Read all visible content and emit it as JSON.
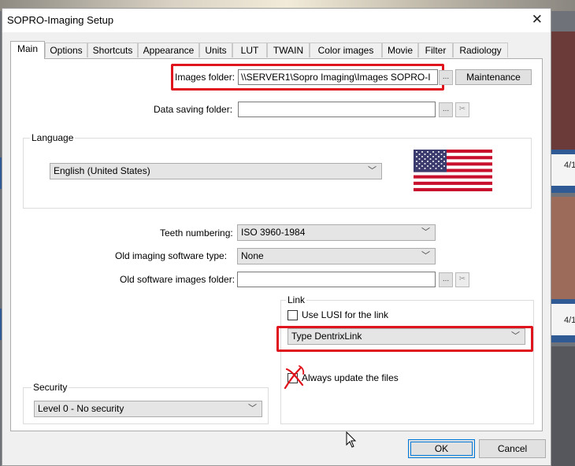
{
  "window": {
    "title": "SOPRO-Imaging Setup",
    "close_glyph": "✕"
  },
  "tabs": [
    {
      "label": "Main",
      "active": true
    },
    {
      "label": "Options"
    },
    {
      "label": "Shortcuts"
    },
    {
      "label": "Appearance"
    },
    {
      "label": "Units"
    },
    {
      "label": "LUT"
    },
    {
      "label": "TWAIN"
    },
    {
      "label": "Color images"
    },
    {
      "label": "Movie"
    },
    {
      "label": "Filter"
    },
    {
      "label": "Radiology"
    }
  ],
  "main": {
    "images_folder": {
      "label": "Images folder:",
      "value": "\\\\SERVER1\\Sopro Imaging\\Images SOPRO-I"
    },
    "browse_button_label": "...",
    "maintenance_button_label": "Maintenance",
    "data_saving_folder": {
      "label": "Data saving folder:",
      "value": ""
    },
    "language": {
      "group_label": "Language",
      "selected": "English (United States)",
      "flag_icon": "us-flag-icon"
    },
    "teeth_numbering": {
      "label": "Teeth numbering:",
      "selected": "ISO 3960-1984"
    },
    "old_software_type": {
      "label": "Old imaging software type:",
      "selected": "None"
    },
    "old_software_folder": {
      "label": "Old software images folder:",
      "value": ""
    },
    "link": {
      "group_label": "Link",
      "use_lusi_label": "Use LUSI for the link",
      "use_lusi_checked": false,
      "type_selected": "Type DentrixLink",
      "always_update_label": "Always update the files",
      "always_update_checked": false
    },
    "security": {
      "group_label": "Security",
      "selected": "Level 0 - No security"
    }
  },
  "footer": {
    "ok_label": "OK",
    "cancel_label": "Cancel"
  },
  "background": {
    "date_fragment_1": "4/1",
    "date_fragment_2": "4/1"
  },
  "colors": {
    "highlight_red": "#e0141c",
    "focus_blue": "#0078d7"
  }
}
